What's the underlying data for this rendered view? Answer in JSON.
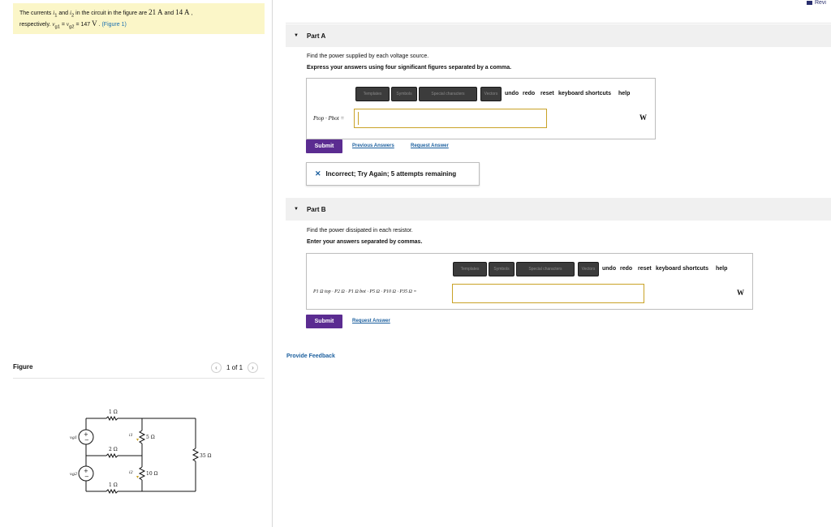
{
  "problem": {
    "t1": "The currents ",
    "i1": "i",
    "i1_sub": "1",
    "t2": " and ",
    "i2": "i",
    "i2_sub": "2",
    "t3": " in the circuit in the figure are ",
    "v21": "21",
    "unitA1": "A",
    "t4": " and ",
    "v14": "14",
    "unitA2": "A",
    "t5": " ,",
    "t6": "respectively. ",
    "vg1": "v",
    "vg1_sub": "g1",
    "eq": " = ",
    "vg2": "v",
    "vg2_sub": "g2",
    "eq2": " = 147 ",
    "unitV": "V",
    "t7": " . ",
    "figure_link": "(Figure 1)"
  },
  "header": {
    "review_label": "Revi"
  },
  "figure": {
    "title": "Figure",
    "pager": "1 of 1",
    "prev_icon": "chevron-left-icon",
    "next_icon": "chevron-right-icon",
    "labels": {
      "r1": "1 Ω",
      "r2": "2 Ω",
      "r3": "1 Ω",
      "r5": "5 Ω",
      "r10": "10 Ω",
      "r35": "35 Ω",
      "vg1": "vg1",
      "vg2": "vg2",
      "i1": "i1",
      "i2": "i2"
    }
  },
  "partA": {
    "title": "Part A",
    "instruction": "Find the power supplied by each voltage source.",
    "express": "Express your answers using four significant figures separated by a comma.",
    "toolbar": {
      "btn1": "Templates",
      "btn2": "Symbols",
      "btn3": "Special characters",
      "btn4": "Vectors",
      "undo": "undo",
      "redo": "redo",
      "reset": "reset",
      "shortcuts": "keyboard shortcuts",
      "help": "help"
    },
    "label": "Ptop · Pbot =",
    "unit": "W",
    "input_value": "",
    "submit": "Submit",
    "previous": "Previous Answers",
    "request": "Request Answer",
    "feedback": "Incorrect; Try Again; 5 attempts remaining"
  },
  "partB": {
    "title": "Part B",
    "instruction": "Find the power dissipated in each resistor.",
    "express": "Enter your answers separated by commas.",
    "toolbar": {
      "btn1": "Templates",
      "btn2": "Symbols",
      "btn3": "Special characters",
      "btn4": "Vectors",
      "undo": "undo",
      "redo": "redo",
      "reset": "reset",
      "shortcuts": "keyboard shortcuts",
      "help": "help"
    },
    "label": "P1 Ω top · P2 Ω · P1 Ω bot · P5 Ω · P10 Ω · P35 Ω =",
    "unit": "W",
    "input_value": "",
    "submit": "Submit",
    "request": "Request Answer"
  },
  "provide_feedback": "Provide Feedback",
  "colors": {
    "accent": "#5b2c91",
    "link": "#1b5f9e",
    "input_border": "#c9a227",
    "problem_bg": "#fbf6c8"
  }
}
